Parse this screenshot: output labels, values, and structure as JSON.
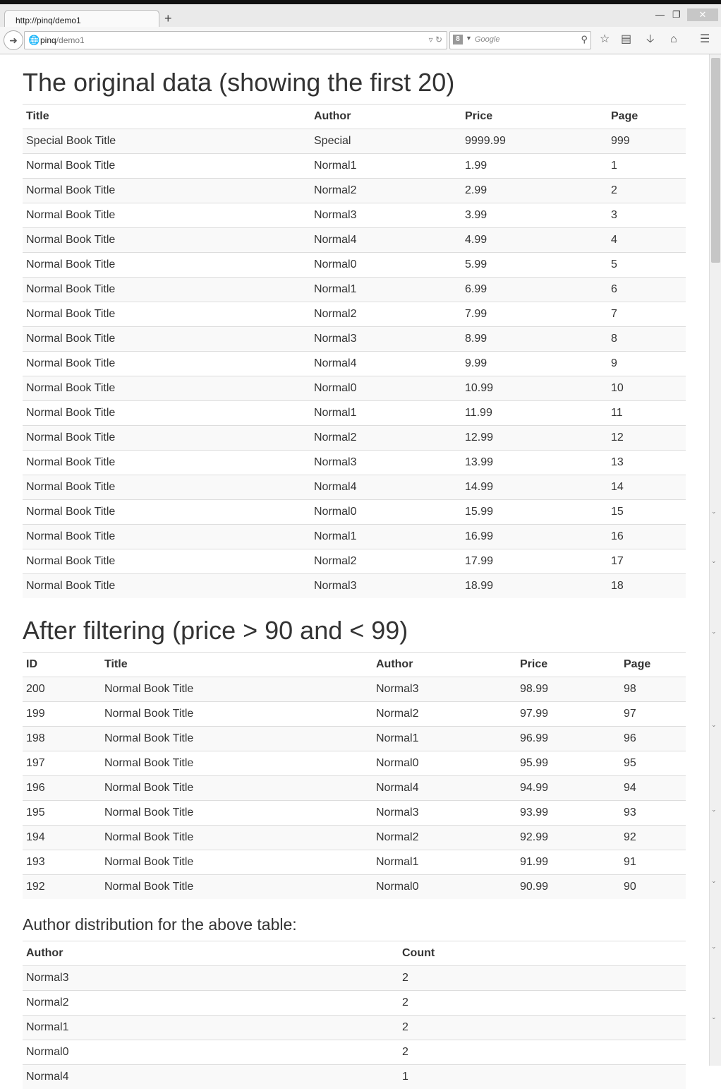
{
  "browser": {
    "tab_title": "http://pinq/demo1",
    "new_tab": "+",
    "url_host": "pinq",
    "url_path": "/demo1",
    "search_placeholder": "Google",
    "search_engine_letter": "8"
  },
  "section1": {
    "heading": "The original data (showing the first 20)",
    "columns": [
      "Title",
      "Author",
      "Price",
      "Page"
    ],
    "rows": [
      [
        "Special Book Title",
        "Special",
        "9999.99",
        "999"
      ],
      [
        "Normal Book Title",
        "Normal1",
        "1.99",
        "1"
      ],
      [
        "Normal Book Title",
        "Normal2",
        "2.99",
        "2"
      ],
      [
        "Normal Book Title",
        "Normal3",
        "3.99",
        "3"
      ],
      [
        "Normal Book Title",
        "Normal4",
        "4.99",
        "4"
      ],
      [
        "Normal Book Title",
        "Normal0",
        "5.99",
        "5"
      ],
      [
        "Normal Book Title",
        "Normal1",
        "6.99",
        "6"
      ],
      [
        "Normal Book Title",
        "Normal2",
        "7.99",
        "7"
      ],
      [
        "Normal Book Title",
        "Normal3",
        "8.99",
        "8"
      ],
      [
        "Normal Book Title",
        "Normal4",
        "9.99",
        "9"
      ],
      [
        "Normal Book Title",
        "Normal0",
        "10.99",
        "10"
      ],
      [
        "Normal Book Title",
        "Normal1",
        "11.99",
        "11"
      ],
      [
        "Normal Book Title",
        "Normal2",
        "12.99",
        "12"
      ],
      [
        "Normal Book Title",
        "Normal3",
        "13.99",
        "13"
      ],
      [
        "Normal Book Title",
        "Normal4",
        "14.99",
        "14"
      ],
      [
        "Normal Book Title",
        "Normal0",
        "15.99",
        "15"
      ],
      [
        "Normal Book Title",
        "Normal1",
        "16.99",
        "16"
      ],
      [
        "Normal Book Title",
        "Normal2",
        "17.99",
        "17"
      ],
      [
        "Normal Book Title",
        "Normal3",
        "18.99",
        "18"
      ]
    ]
  },
  "section2": {
    "heading": "After filtering (price > 90 and < 99)",
    "columns": [
      "ID",
      "Title",
      "Author",
      "Price",
      "Page"
    ],
    "rows": [
      [
        "200",
        "Normal Book Title",
        "Normal3",
        "98.99",
        "98"
      ],
      [
        "199",
        "Normal Book Title",
        "Normal2",
        "97.99",
        "97"
      ],
      [
        "198",
        "Normal Book Title",
        "Normal1",
        "96.99",
        "96"
      ],
      [
        "197",
        "Normal Book Title",
        "Normal0",
        "95.99",
        "95"
      ],
      [
        "196",
        "Normal Book Title",
        "Normal4",
        "94.99",
        "94"
      ],
      [
        "195",
        "Normal Book Title",
        "Normal3",
        "93.99",
        "93"
      ],
      [
        "194",
        "Normal Book Title",
        "Normal2",
        "92.99",
        "92"
      ],
      [
        "193",
        "Normal Book Title",
        "Normal1",
        "91.99",
        "91"
      ],
      [
        "192",
        "Normal Book Title",
        "Normal0",
        "90.99",
        "90"
      ]
    ]
  },
  "section3": {
    "heading": "Author distribution for the above table:",
    "columns": [
      "Author",
      "Count"
    ],
    "rows": [
      [
        "Normal3",
        "2"
      ],
      [
        "Normal2",
        "2"
      ],
      [
        "Normal1",
        "2"
      ],
      [
        "Normal0",
        "2"
      ],
      [
        "Normal4",
        "1"
      ]
    ]
  }
}
